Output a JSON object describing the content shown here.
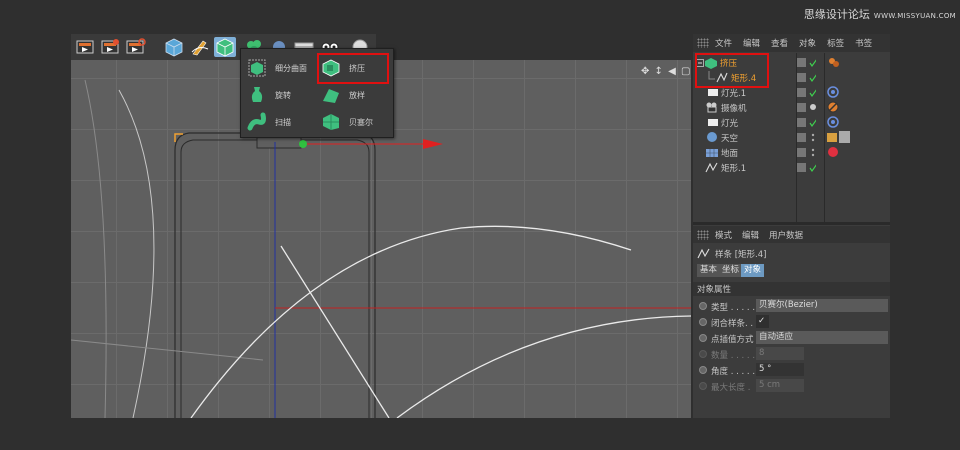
{
  "watermark": {
    "text": "思缘设计论坛",
    "url": "WWW.MISSYUAN.COM"
  },
  "toolbar": {
    "icons": [
      "render-view-icon",
      "render-settings-icon",
      "render-icon",
      "cube-icon",
      "pen-spline-icon",
      "subdivision-active-icon",
      "plant-icon",
      "camera-icon",
      "light-icon",
      "toggle-icon"
    ]
  },
  "viewport": {
    "nav_icons": "✥ ↕ ◀ ▢"
  },
  "popup": {
    "items": [
      {
        "label": "细分曲面"
      },
      {
        "label": "挤压"
      },
      {
        "label": "旋转"
      },
      {
        "label": "放样"
      },
      {
        "label": "扫描"
      },
      {
        "label": "贝塞尔"
      }
    ]
  },
  "object_manager": {
    "menu": [
      "文件",
      "编辑",
      "查看",
      "对象",
      "标签",
      "书签"
    ],
    "objects": [
      {
        "name": "挤压",
        "color": "#f0a030"
      },
      {
        "name": "矩形.4",
        "color": "#f0a030"
      },
      {
        "name": "灯光.1",
        "color": "#c8c8c8"
      },
      {
        "name": "摄像机",
        "color": "#c8c8c8"
      },
      {
        "name": "灯光",
        "color": "#c8c8c8"
      },
      {
        "name": "天空",
        "color": "#c8c8c8"
      },
      {
        "name": "地面",
        "color": "#c8c8c8"
      },
      {
        "name": "矩形.1",
        "color": "#c8c8c8"
      }
    ]
  },
  "attributes": {
    "menu": [
      "模式",
      "编辑",
      "用户数据"
    ],
    "header": "样条 [矩形.4]",
    "tabs": [
      "基本",
      "坐标",
      "对象"
    ],
    "section": "对象属性",
    "props": [
      {
        "label": "类型 . . . . .",
        "value": "贝赛尔(Bezier)"
      },
      {
        "label": "闭合样条. . .",
        "value": "✓"
      },
      {
        "label": "点插值方式",
        "value": "自动适应"
      },
      {
        "label": "数量 . . . . .",
        "value": "8"
      },
      {
        "label": "角度 . . . . .",
        "value": "5 °"
      },
      {
        "label": "最大长度 .",
        "value": "5 cm"
      }
    ]
  },
  "colors": {
    "highlight": "#e01010",
    "accent": "#6d9ac2",
    "selection": "#f0a030"
  }
}
